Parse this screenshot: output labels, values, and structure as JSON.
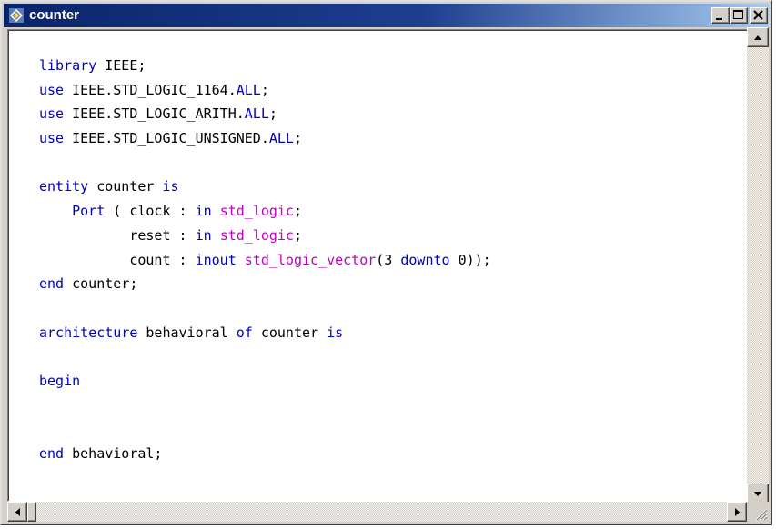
{
  "window": {
    "title": "counter",
    "icon": "vhdl-editor-icon",
    "controls": [
      "minimize-icon",
      "maximize-icon",
      "close-icon"
    ]
  },
  "editor": {
    "language": "VHDL",
    "colors": {
      "keyword": "#0000c0",
      "type": "#c000c0",
      "text": "#000000"
    },
    "lines": [
      [
        {
          "k": "kw",
          "t": "library"
        },
        {
          "k": "tx",
          "t": " IEEE;"
        }
      ],
      [
        {
          "k": "kw",
          "t": "use"
        },
        {
          "k": "tx",
          "t": " IEEE.STD_LOGIC_1164."
        },
        {
          "k": "kw",
          "t": "ALL"
        },
        {
          "k": "tx",
          "t": ";"
        }
      ],
      [
        {
          "k": "kw",
          "t": "use"
        },
        {
          "k": "tx",
          "t": " IEEE.STD_LOGIC_ARITH."
        },
        {
          "k": "kw",
          "t": "ALL"
        },
        {
          "k": "tx",
          "t": ";"
        }
      ],
      [
        {
          "k": "kw",
          "t": "use"
        },
        {
          "k": "tx",
          "t": " IEEE.STD_LOGIC_UNSIGNED."
        },
        {
          "k": "kw",
          "t": "ALL"
        },
        {
          "k": "tx",
          "t": ";"
        }
      ],
      [],
      [
        {
          "k": "kw",
          "t": "entity"
        },
        {
          "k": "tx",
          "t": " counter "
        },
        {
          "k": "kw",
          "t": "is"
        }
      ],
      [
        {
          "k": "tx",
          "t": "    "
        },
        {
          "k": "kw",
          "t": "Port"
        },
        {
          "k": "tx",
          "t": " ( clock : "
        },
        {
          "k": "kw",
          "t": "in"
        },
        {
          "k": "tx",
          "t": " "
        },
        {
          "k": "ty",
          "t": "std_logic"
        },
        {
          "k": "tx",
          "t": ";"
        }
      ],
      [
        {
          "k": "tx",
          "t": "           reset : "
        },
        {
          "k": "kw",
          "t": "in"
        },
        {
          "k": "tx",
          "t": " "
        },
        {
          "k": "ty",
          "t": "std_logic"
        },
        {
          "k": "tx",
          "t": ";"
        }
      ],
      [
        {
          "k": "tx",
          "t": "           count : "
        },
        {
          "k": "kw",
          "t": "inout"
        },
        {
          "k": "tx",
          "t": " "
        },
        {
          "k": "ty",
          "t": "std_logic_vector"
        },
        {
          "k": "tx",
          "t": "(3 "
        },
        {
          "k": "kw",
          "t": "downto"
        },
        {
          "k": "tx",
          "t": " 0));"
        }
      ],
      [
        {
          "k": "kw",
          "t": "end"
        },
        {
          "k": "tx",
          "t": " counter;"
        }
      ],
      [],
      [
        {
          "k": "kw",
          "t": "architecture"
        },
        {
          "k": "tx",
          "t": " behavioral "
        },
        {
          "k": "kw",
          "t": "of"
        },
        {
          "k": "tx",
          "t": " counter "
        },
        {
          "k": "kw",
          "t": "is"
        }
      ],
      [],
      [
        {
          "k": "kw",
          "t": "begin"
        }
      ],
      [],
      [],
      [
        {
          "k": "kw",
          "t": "end"
        },
        {
          "k": "tx",
          "t": " behavioral;"
        }
      ]
    ]
  },
  "scrollbars": {
    "vertical": {
      "position": 0
    },
    "horizontal": {
      "position": 0
    }
  }
}
